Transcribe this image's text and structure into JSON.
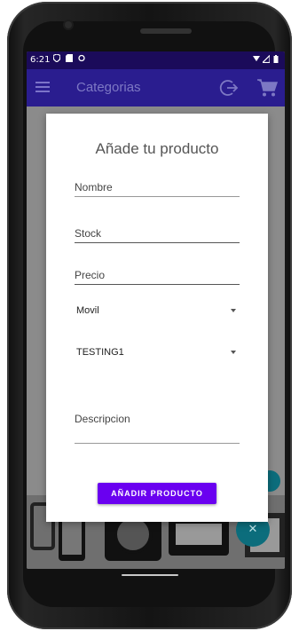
{
  "status_bar": {
    "time": "6:21",
    "left_icons": [
      "shield-icon",
      "sim-card-icon",
      "sync-icon"
    ],
    "right_icons": [
      "wifi-icon",
      "signal-icon",
      "battery-icon"
    ]
  },
  "app_bar": {
    "title": "Categorias",
    "icons": [
      "menu-icon",
      "logout-icon",
      "cart-icon"
    ],
    "color": "#2a1d8f"
  },
  "dialog": {
    "title": "Añade tu producto",
    "fields": {
      "nombre": {
        "placeholder": "Nombre"
      },
      "stock": {
        "placeholder": "Stock"
      },
      "precio": {
        "placeholder": "Precio"
      },
      "descripcion": {
        "placeholder": "Descripcion"
      }
    },
    "spinners": {
      "category": {
        "value": "Movil"
      },
      "subcategory": {
        "value": "TESTING1"
      }
    },
    "submit_label": "AÑADIR PRODUCTO",
    "button_color": "#6a00f0"
  },
  "fab": {
    "icon": "close-icon"
  }
}
